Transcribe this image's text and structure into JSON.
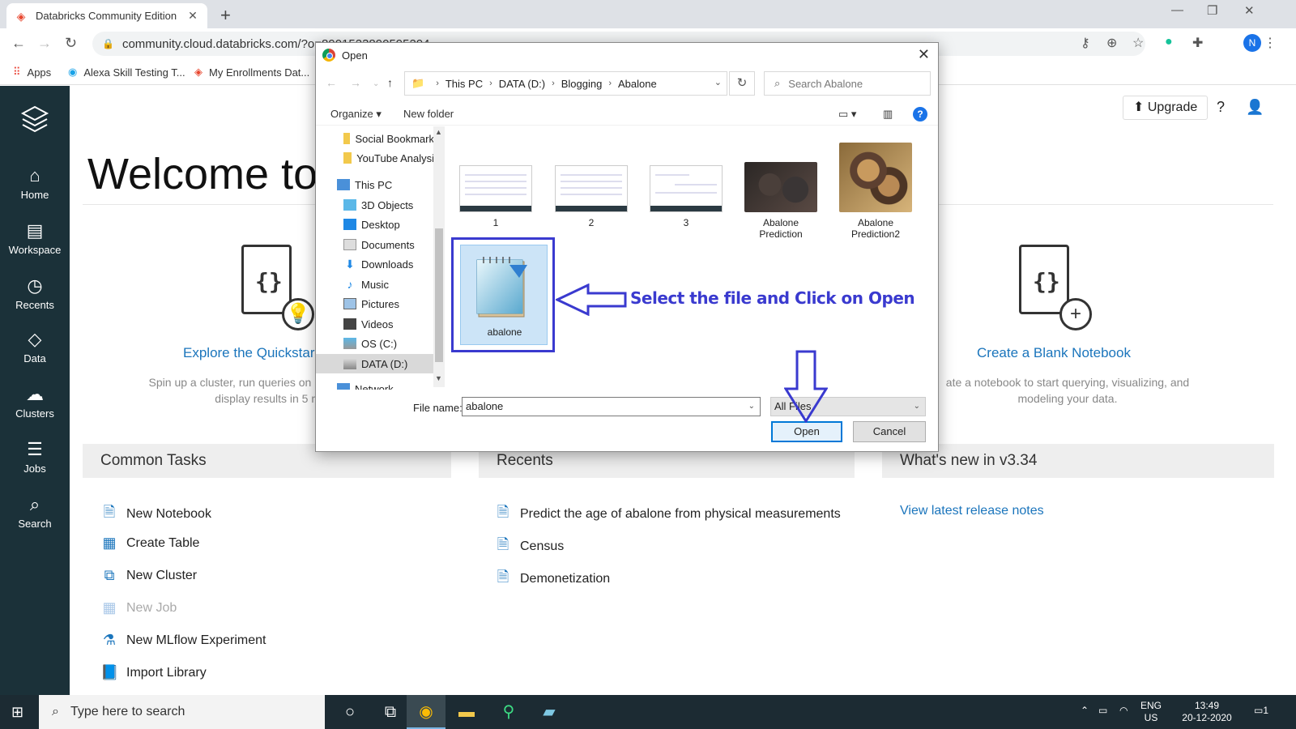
{
  "browser": {
    "tab_title": "Databricks Community Edition",
    "url": "community.cloud.databricks.com/?o=8901523890595294",
    "bookmarks": [
      {
        "label": "Apps"
      },
      {
        "label": "Alexa Skill Testing T..."
      },
      {
        "label": "My Enrollments Dat..."
      }
    ],
    "profile_initial": "N"
  },
  "sidebar": {
    "items": [
      {
        "label": "Home",
        "icon": "home-icon"
      },
      {
        "label": "Workspace",
        "icon": "workspace-icon"
      },
      {
        "label": "Recents",
        "icon": "clock-icon"
      },
      {
        "label": "Data",
        "icon": "data-icon"
      },
      {
        "label": "Clusters",
        "icon": "clusters-icon"
      },
      {
        "label": "Jobs",
        "icon": "jobs-icon"
      },
      {
        "label": "Search",
        "icon": "search-icon"
      }
    ]
  },
  "header": {
    "upgrade_label": "Upgrade"
  },
  "main": {
    "welcome": "Welcome to",
    "quickstart_title": "Explore the Quickstar",
    "quickstart_desc_1": "Spin up a cluster, run queries on p",
    "quickstart_desc_2": "display results in 5 m",
    "blank_title": "Create a Blank Notebook",
    "blank_desc_1": "ate a notebook to start querying, visualizing, and",
    "blank_desc_2": "modeling your data.",
    "common_tasks_title": "Common Tasks",
    "recents_title": "Recents",
    "whatsnew_title": "What's new in v3.34",
    "tasks": [
      {
        "label": "New Notebook"
      },
      {
        "label": "Create Table"
      },
      {
        "label": "New Cluster"
      },
      {
        "label": "New Job"
      },
      {
        "label": "New MLflow Experiment"
      },
      {
        "label": "Import Library"
      }
    ],
    "recents": [
      {
        "label": "Predict the age of abalone from physical measurements"
      },
      {
        "label": "Census"
      },
      {
        "label": "Demonetization"
      }
    ],
    "release_notes": "View latest release notes"
  },
  "dialog": {
    "title": "Open",
    "breadcrumb": [
      "This PC",
      "DATA (D:)",
      "Blogging",
      "Abalone"
    ],
    "search_placeholder": "Search Abalone",
    "organize": "Organize",
    "new_folder": "New folder",
    "tree": [
      {
        "label": "Social Bookmark"
      },
      {
        "label": "YouTube Analysi"
      },
      {
        "label": "This PC"
      },
      {
        "label": "3D Objects"
      },
      {
        "label": "Desktop"
      },
      {
        "label": "Documents"
      },
      {
        "label": "Downloads"
      },
      {
        "label": "Music"
      },
      {
        "label": "Pictures"
      },
      {
        "label": "Videos"
      },
      {
        "label": "OS (C:)"
      },
      {
        "label": "DATA (D:)"
      },
      {
        "label": "Network"
      }
    ],
    "files": [
      {
        "label": "1"
      },
      {
        "label": "2"
      },
      {
        "label": "3"
      },
      {
        "label": "Abalone Prediction",
        "line1": "Abalone",
        "line2": "Prediction"
      },
      {
        "label": "Abalone Prediction2",
        "line1": "Abalone",
        "line2": "Prediction2"
      },
      {
        "label": "abalone"
      }
    ],
    "file_name_label": "File name:",
    "file_name_value": "abalone",
    "file_type": "All Files",
    "open_label": "Open",
    "cancel_label": "Cancel"
  },
  "annotation": {
    "text": "Select the file and Click on Open",
    "color": "#3a3acf"
  },
  "taskbar": {
    "search_placeholder": "Type here to search",
    "lang_1": "ENG",
    "lang_2": "US",
    "time": "13:49",
    "date": "20-12-2020",
    "notifications": "1"
  }
}
